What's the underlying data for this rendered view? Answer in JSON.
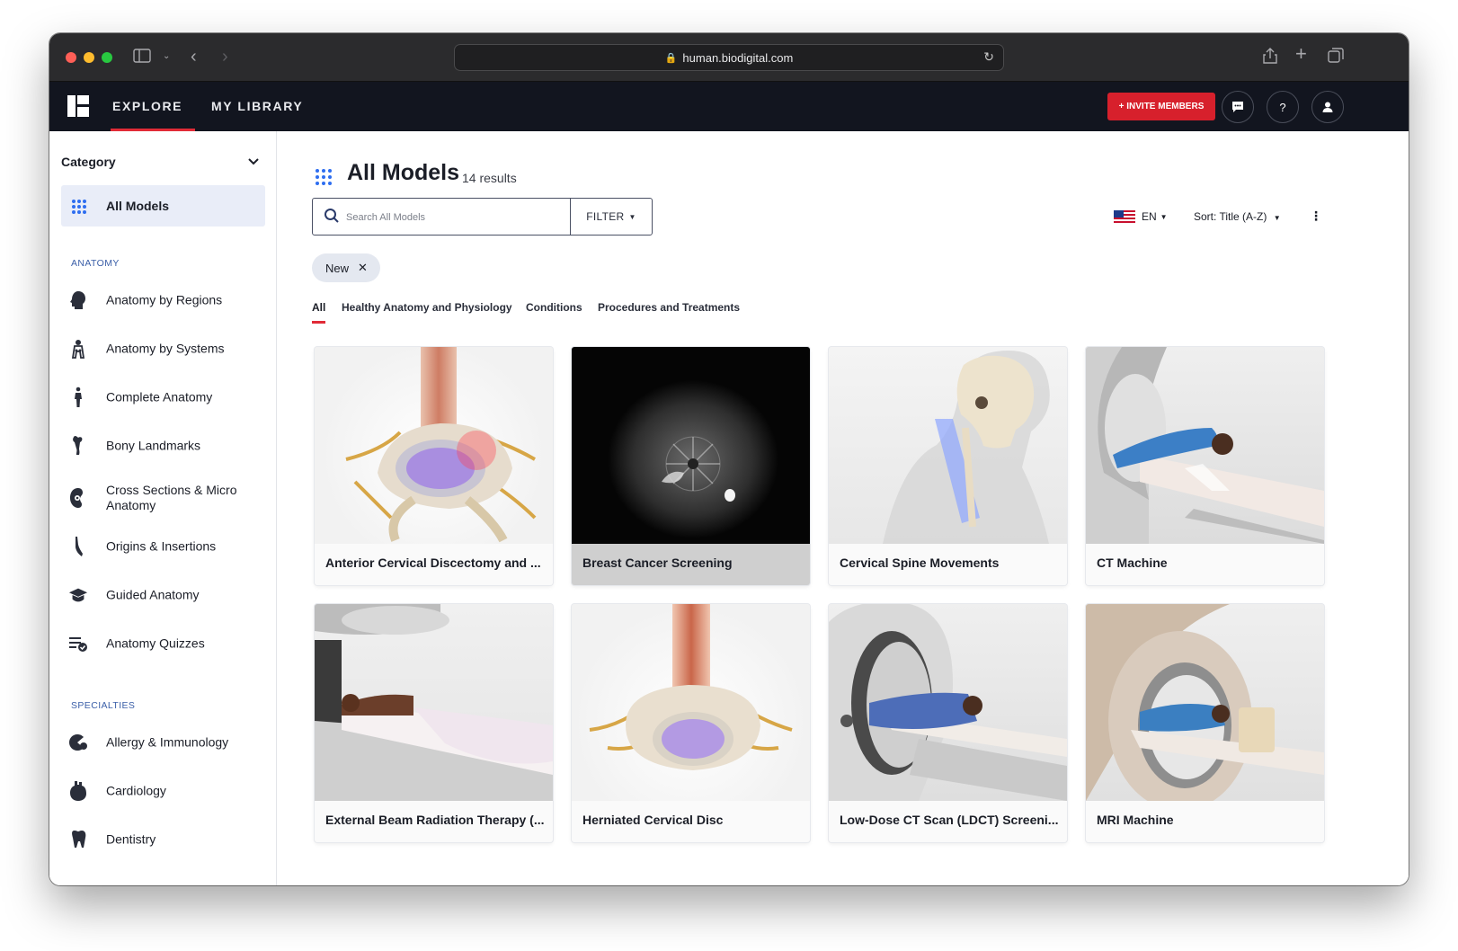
{
  "browser": {
    "url": "human.biodigital.com"
  },
  "nav": {
    "explore": "EXPLORE",
    "my_library": "MY LIBRARY",
    "invite": "+ INVITE MEMBERS",
    "help": "?"
  },
  "sidebar": {
    "category": "Category",
    "all_models": "All Models",
    "anatomy_heading": "ANATOMY",
    "anatomy_items": [
      {
        "label": "Anatomy by Regions",
        "icon": "head-icon"
      },
      {
        "label": "Anatomy by Systems",
        "icon": "body-systems-icon"
      },
      {
        "label": "Complete Anatomy",
        "icon": "human-figure-icon"
      },
      {
        "label": "Bony Landmarks",
        "icon": "bone-icon"
      },
      {
        "label": "Cross Sections & Micro Anatomy",
        "icon": "cross-section-icon"
      },
      {
        "label": "Origins & Insertions",
        "icon": "muscle-icon"
      },
      {
        "label": "Guided Anatomy",
        "icon": "graduation-cap-icon"
      },
      {
        "label": "Anatomy Quizzes",
        "icon": "quiz-icon"
      }
    ],
    "specialties_heading": "SPECIALTIES",
    "specialty_items": [
      {
        "label": "Allergy & Immunology",
        "icon": "allergy-icon"
      },
      {
        "label": "Cardiology",
        "icon": "heart-icon"
      },
      {
        "label": "Dentistry",
        "icon": "tooth-icon"
      }
    ]
  },
  "main": {
    "title": "All Models",
    "results": "14 results",
    "search_placeholder": "Search All Models",
    "filter": "FILTER",
    "language": "EN",
    "sort": "Sort: Title (A-Z)",
    "chip": "New",
    "tabs": [
      "All",
      "Healthy Anatomy and Physiology",
      "Conditions",
      "Procedures and Treatments"
    ],
    "cards": [
      "Anterior Cervical Discectomy and ...",
      "Breast Cancer Screening",
      "Cervical Spine Movements",
      "CT Machine",
      "External Beam Radiation Therapy (...",
      "Herniated Cervical Disc",
      "Low-Dose CT Scan (LDCT) Screeni...",
      "MRI Machine"
    ]
  },
  "colors": {
    "nav_bg": "#12151f",
    "accent": "#d7202c",
    "link_blue": "#2e6ef0"
  }
}
